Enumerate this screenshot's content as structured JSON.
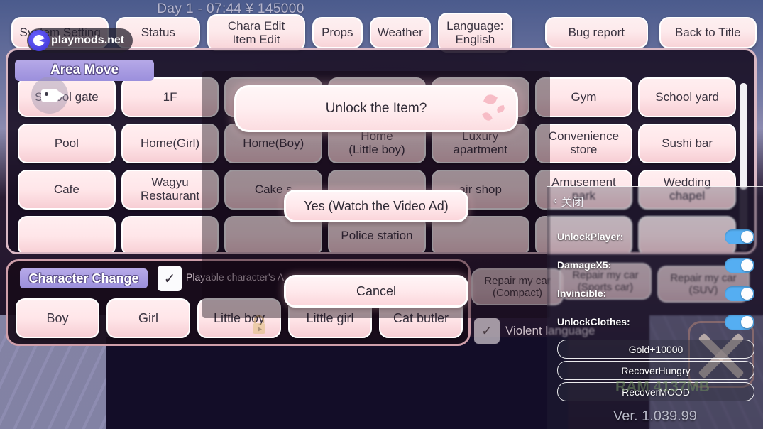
{
  "hud": {
    "status_text": "Day 1 - 07:44  ¥ 145000"
  },
  "watermark": {
    "text": "playmods.net",
    "logo_icon": "playmods-logo-icon",
    "camera_icon": "video-camera-icon"
  },
  "topbar": {
    "buttons": [
      {
        "label": "System Setting",
        "class": "tb-sys",
        "name": "system-setting-button"
      },
      {
        "label": "Status",
        "class": "tb-status",
        "name": "status-button"
      },
      {
        "label": "Chara Edit\nItem Edit",
        "class": "tb-chara",
        "name": "chara-item-edit-button"
      },
      {
        "label": "Props",
        "class": "tb-props",
        "name": "props-button"
      },
      {
        "label": "Weather",
        "class": "tb-weather",
        "name": "weather-button"
      },
      {
        "label": "Language:\nEnglish",
        "class": "tb-lang",
        "name": "language-button"
      },
      {
        "label": "Bug report",
        "class": "tb-bug",
        "name": "bug-report-button"
      },
      {
        "label": "Back to Title",
        "class": "tb-back",
        "name": "back-to-title-button"
      }
    ]
  },
  "area_move": {
    "title": "Area Move",
    "cells": [
      "School gate",
      "1F",
      "",
      "",
      "",
      "Gym",
      "School yard",
      "Pool",
      "Home(Girl)",
      "Home(Boy)",
      "Home\n(Little boy)",
      "Luxury\napartment",
      "Convenience\nstore",
      "Sushi bar",
      "Cafe",
      "Wagyu\nRestaurant",
      "Cake s",
      "",
      "air shop",
      "Amusement\npark",
      "Wedding\nchapel",
      "",
      "",
      "",
      "Police station",
      "",
      "",
      ""
    ]
  },
  "dialog": {
    "title": "Unlock the Item?",
    "yes_label": "Yes (Watch the Video Ad)",
    "cancel_label": "Cancel"
  },
  "character_change": {
    "title": "Character Change",
    "checkbox_checked": true,
    "check_glyph": "✓",
    "checkbox_label": "Playable character's A",
    "buttons": [
      {
        "label": "Boy",
        "locked": false
      },
      {
        "label": "Girl",
        "locked": false
      },
      {
        "label": "Little boy",
        "locked": true
      },
      {
        "label": "Little girl",
        "locked": false
      },
      {
        "label": "Cat butler",
        "locked": false
      }
    ]
  },
  "background_items": {
    "repair_compact": "Repair my car\n(Compact)",
    "violent_language": "Violent language",
    "violent_check_glyph": "✓"
  },
  "mod_panel": {
    "close_label": "关闭",
    "close_chevron": "‹",
    "toggles": [
      {
        "label": "UnlockPlayer:",
        "on": true
      },
      {
        "label": "DamageX5:",
        "on": true
      },
      {
        "label": "Invincible:",
        "on": true
      },
      {
        "label": "UnlockClothes:",
        "on": true
      }
    ],
    "actions": [
      "Gold+10000",
      "RecoverHungry",
      "RecoverMOOD"
    ],
    "version": "Ver. 1.039.99",
    "ram_text": "RAM 4137MB",
    "close_x_icon": "close-x-icon"
  },
  "behind_mod": {
    "repair_sports": "Repair my car\n(Sports car)",
    "repair_suv": "Repair my car\n(SUV)"
  },
  "colors": {
    "accent_pink": "#ffe6e9",
    "toggle_on": "#55aef2",
    "title_purple": "#9b8fdc"
  }
}
